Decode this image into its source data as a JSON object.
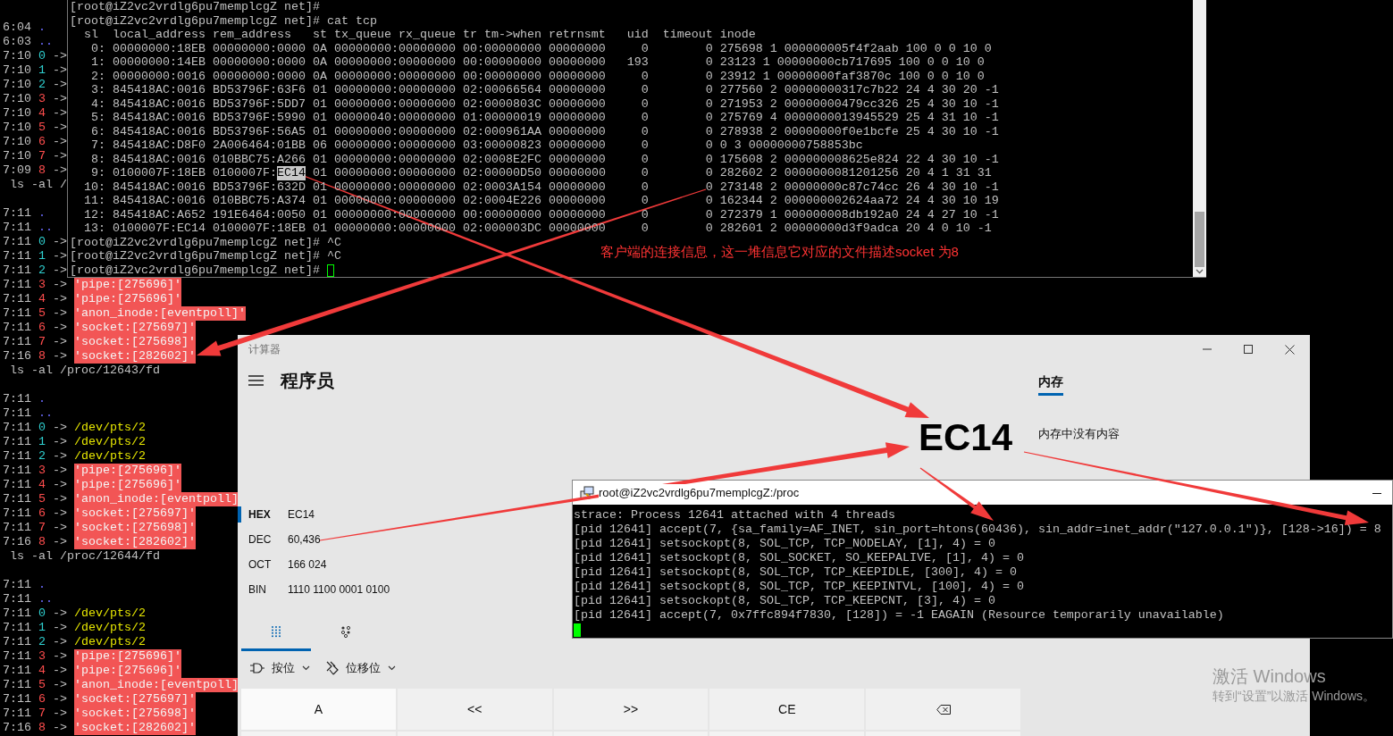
{
  "left_terminal": {
    "lines": [
      {
        "kind": "entry",
        "time": "6:04",
        "name": {
          "text": ".",
          "kind": "dir"
        }
      },
      {
        "kind": "entry",
        "time": "6:03",
        "name": {
          "text": "..",
          "kind": "dir"
        }
      },
      {
        "kind": "entry",
        "time": "7:10",
        "name": {
          "text": "0",
          "kind": "std"
        },
        "arrow": "->"
      },
      {
        "kind": "entry",
        "time": "7:10",
        "name": {
          "text": "1",
          "kind": "std"
        },
        "arrow": "->"
      },
      {
        "kind": "entry",
        "time": "7:10",
        "name": {
          "text": "2",
          "kind": "std"
        },
        "arrow": "->"
      },
      {
        "kind": "entry",
        "time": "7:10",
        "name": {
          "text": "3",
          "kind": "fd"
        },
        "arrow": "->"
      },
      {
        "kind": "entry",
        "time": "7:10",
        "name": {
          "text": "4",
          "kind": "fd"
        },
        "arrow": "->"
      },
      {
        "kind": "entry",
        "time": "7:10",
        "name": {
          "text": "5",
          "kind": "fd"
        },
        "arrow": "->"
      },
      {
        "kind": "entry",
        "time": "7:10",
        "name": {
          "text": "6",
          "kind": "fd"
        },
        "arrow": "->"
      },
      {
        "kind": "entry",
        "time": "7:10",
        "name": {
          "text": "7",
          "kind": "fd"
        },
        "arrow": "->"
      },
      {
        "kind": "entry",
        "time": "7:09",
        "name": {
          "text": "8",
          "kind": "fd"
        },
        "arrow": "->"
      },
      {
        "kind": "command",
        "text": " ls -al /"
      },
      {
        "kind": "blank"
      },
      {
        "kind": "entry",
        "time": "7:11",
        "name": {
          "text": ".",
          "kind": "dir"
        }
      },
      {
        "kind": "entry",
        "time": "7:11",
        "name": {
          "text": "..",
          "kind": "dir"
        }
      },
      {
        "kind": "entry",
        "time": "7:11",
        "name": {
          "text": "0",
          "kind": "std"
        },
        "arrow": "->"
      },
      {
        "kind": "entry",
        "time": "7:11",
        "name": {
          "text": "1",
          "kind": "std"
        },
        "arrow": "->"
      },
      {
        "kind": "entry",
        "time": "7:11",
        "name": {
          "text": "2",
          "kind": "std"
        },
        "arrow": "->"
      },
      {
        "kind": "entry",
        "time": "7:11",
        "name": {
          "text": "3",
          "kind": "fd"
        },
        "arrow": "->",
        "target": {
          "text": "'pipe:[275696]'",
          "kind": "special"
        }
      },
      {
        "kind": "entry",
        "time": "7:11",
        "name": {
          "text": "4",
          "kind": "fd"
        },
        "arrow": "->",
        "target": {
          "text": "'pipe:[275696]'",
          "kind": "special"
        }
      },
      {
        "kind": "entry",
        "time": "7:11",
        "name": {
          "text": "5",
          "kind": "fd"
        },
        "arrow": "->",
        "target": {
          "text": "'anon_inode:[eventpoll]'",
          "kind": "special"
        }
      },
      {
        "kind": "entry",
        "time": "7:11",
        "name": {
          "text": "6",
          "kind": "fd"
        },
        "arrow": "->",
        "target": {
          "text": "'socket:[275697]'",
          "kind": "special"
        }
      },
      {
        "kind": "entry",
        "time": "7:11",
        "name": {
          "text": "7",
          "kind": "fd"
        },
        "arrow": "->",
        "target": {
          "text": "'socket:[275698]'",
          "kind": "special"
        }
      },
      {
        "kind": "entry",
        "time": "7:16",
        "name": {
          "text": "8",
          "kind": "fd"
        },
        "arrow": "->",
        "target": {
          "text": "'socket:[282602]'",
          "kind": "special"
        }
      },
      {
        "kind": "command",
        "text": " ls -al /proc/12643/fd"
      },
      {
        "kind": "blank"
      },
      {
        "kind": "entry",
        "time": "7:11",
        "name": {
          "text": ".",
          "kind": "dir"
        }
      },
      {
        "kind": "entry",
        "time": "7:11",
        "name": {
          "text": "..",
          "kind": "dir"
        }
      },
      {
        "kind": "entry",
        "time": "7:11",
        "name": {
          "text": "0",
          "kind": "std"
        },
        "arrow": "->",
        "target": {
          "text": "/dev/pts/2",
          "kind": "tty"
        }
      },
      {
        "kind": "entry",
        "time": "7:11",
        "name": {
          "text": "1",
          "kind": "std"
        },
        "arrow": "->",
        "target": {
          "text": "/dev/pts/2",
          "kind": "tty"
        }
      },
      {
        "kind": "entry",
        "time": "7:11",
        "name": {
          "text": "2",
          "kind": "std"
        },
        "arrow": "->",
        "target": {
          "text": "/dev/pts/2",
          "kind": "tty"
        }
      },
      {
        "kind": "entry",
        "time": "7:11",
        "name": {
          "text": "3",
          "kind": "fd"
        },
        "arrow": "->",
        "target": {
          "text": "'pipe:[275696]'",
          "kind": "special"
        }
      },
      {
        "kind": "entry",
        "time": "7:11",
        "name": {
          "text": "4",
          "kind": "fd"
        },
        "arrow": "->",
        "target": {
          "text": "'pipe:[275696]'",
          "kind": "special"
        }
      },
      {
        "kind": "entry",
        "time": "7:11",
        "name": {
          "text": "5",
          "kind": "fd"
        },
        "arrow": "->",
        "target": {
          "text": "'anon_inode:[eventpoll]",
          "kind": "special"
        }
      },
      {
        "kind": "entry",
        "time": "7:11",
        "name": {
          "text": "6",
          "kind": "fd"
        },
        "arrow": "->",
        "target": {
          "text": "'socket:[275697]'",
          "kind": "special"
        }
      },
      {
        "kind": "entry",
        "time": "7:11",
        "name": {
          "text": "7",
          "kind": "fd"
        },
        "arrow": "->",
        "target": {
          "text": "'socket:[275698]'",
          "kind": "special"
        }
      },
      {
        "kind": "entry",
        "time": "7:16",
        "name": {
          "text": "8",
          "kind": "fd"
        },
        "arrow": "->",
        "target": {
          "text": "'socket:[282602]'",
          "kind": "special"
        }
      },
      {
        "kind": "command",
        "text": " ls -al /proc/12644/fd"
      },
      {
        "kind": "blank"
      },
      {
        "kind": "entry",
        "time": "7:11",
        "name": {
          "text": ".",
          "kind": "dir"
        }
      },
      {
        "kind": "entry",
        "time": "7:11",
        "name": {
          "text": "..",
          "kind": "dir"
        }
      },
      {
        "kind": "entry",
        "time": "7:11",
        "name": {
          "text": "0",
          "kind": "std"
        },
        "arrow": "->",
        "target": {
          "text": "/dev/pts/2",
          "kind": "tty"
        }
      },
      {
        "kind": "entry",
        "time": "7:11",
        "name": {
          "text": "1",
          "kind": "std"
        },
        "arrow": "->",
        "target": {
          "text": "/dev/pts/2",
          "kind": "tty"
        }
      },
      {
        "kind": "entry",
        "time": "7:11",
        "name": {
          "text": "2",
          "kind": "std"
        },
        "arrow": "->",
        "target": {
          "text": "/dev/pts/2",
          "kind": "tty"
        }
      },
      {
        "kind": "entry",
        "time": "7:11",
        "name": {
          "text": "3",
          "kind": "fd"
        },
        "arrow": "->",
        "target": {
          "text": "'pipe:[275696]'",
          "kind": "special"
        }
      },
      {
        "kind": "entry",
        "time": "7:11",
        "name": {
          "text": "4",
          "kind": "fd"
        },
        "arrow": "->",
        "target": {
          "text": "'pipe:[275696]'",
          "kind": "special"
        }
      },
      {
        "kind": "entry",
        "time": "7:11",
        "name": {
          "text": "5",
          "kind": "fd"
        },
        "arrow": "->",
        "target": {
          "text": "'anon_inode:[eventpoll]",
          "kind": "special"
        }
      },
      {
        "kind": "entry",
        "time": "7:11",
        "name": {
          "text": "6",
          "kind": "fd"
        },
        "arrow": "->",
        "target": {
          "text": "'socket:[275697]'",
          "kind": "special"
        }
      },
      {
        "kind": "entry",
        "time": "7:11",
        "name": {
          "text": "7",
          "kind": "fd"
        },
        "arrow": "->",
        "target": {
          "text": "'socket:[275698]'",
          "kind": "special"
        }
      },
      {
        "kind": "entry",
        "time": "7:16",
        "name": {
          "text": "8",
          "kind": "fd"
        },
        "arrow": "->",
        "target": {
          "text": "'socket:[282602]'",
          "kind": "special"
        }
      }
    ]
  },
  "tcp_terminal": {
    "lines": [
      {
        "text": "[root@iZ2vc2vrdlg6pu7memplcgZ net]#"
      },
      {
        "text": "[root@iZ2vc2vrdlg6pu7memplcgZ net]# cat tcp"
      },
      {
        "text": "  sl  local_address rem_address   st tx_queue rx_queue tr tm->when retrnsmt   uid  timeout inode"
      },
      {
        "text": "   0: 00000000:18EB 00000000:0000 0A 00000000:00000000 00:00000000 00000000     0        0 275698 1 000000005f4f2aab 100 0 0 10 0"
      },
      {
        "text": "   1: 00000000:14EB 00000000:0000 0A 00000000:00000000 00:00000000 00000000   193        0 23123 1 00000000cb717695 100 0 0 10 0"
      },
      {
        "text": "   2: 00000000:0016 00000000:0000 0A 00000000:00000000 00:00000000 00000000     0        0 23912 1 00000000faf3870c 100 0 0 10 0"
      },
      {
        "text": "   3: 845418AC:0016 BD53796F:63F6 01 00000000:00000000 02:00066564 00000000     0        0 277560 2 00000000317c7b22 24 4 30 20 -1"
      },
      {
        "text": "   4: 845418AC:0016 BD53796F:5DD7 01 00000000:00000000 02:0000803C 00000000     0        0 271953 2 00000000479cc326 25 4 30 10 -1"
      },
      {
        "text": "   5: 845418AC:0016 BD53796F:5990 01 00000040:00000000 01:00000019 00000000     0        0 275769 4 0000000013945529 25 4 31 10 -1"
      },
      {
        "text": "   6: 845418AC:0016 BD53796F:56A5 01 00000000:00000000 02:000961AA 00000000     0        0 278938 2 00000000f0e1bcfe 25 4 30 10 -1"
      },
      {
        "text": "   7: 845418AC:D8F0 2A006464:01BB 06 00000000:00000000 03:00000823 00000000     0        0 0 3 00000000758853bc"
      },
      {
        "text": "   8: 845418AC:0016 010BBC75:A266 01 00000000:00000000 02:0008E2FC 00000000     0        0 175608 2 000000008625e824 22 4 30 10 -1"
      },
      {
        "text": "   9: 0100007F:18EB 0100007F:",
        "selected_text": "EC14",
        "text_after": " 01 00000000:00000000 02:00000D50 00000000     0        0 282602 2 0000000081201256 20 4 1 31 31"
      },
      {
        "text": "  10: 845418AC:0016 BD53796F:632D 01 00000000:00000000 02:0003A154 00000000     0        0 273148 2 00000000c87c74cc 26 4 30 10 -1"
      },
      {
        "text": "  11: 845418AC:0016 010BBC75:A374 01 00000000:00000000 02:0004E226 00000000     0        0 162344 2 000000002624aa72 24 4 30 10 19"
      },
      {
        "text": "  12: 845418AC:A652 191E6464:0050 01 00000000:00000000 00:00000000 00000000     0        0 272379 1 000000008db192a0 24 4 27 10 -1"
      },
      {
        "text": "  13: 0100007F:EC14 0100007F:18EB 01 00000000:00000000 02:000003DC 00000000     0        0 282601 2 00000000d3f9adca 20 4 0 10 -1"
      },
      {
        "text": "[root@iZ2vc2vrdlg6pu7memplcgZ net]# ^C"
      },
      {
        "text": "[root@iZ2vc2vrdlg6pu7memplcgZ net]# ^C"
      },
      {
        "text": "[root@iZ2vc2vrdlg6pu7memplcgZ net]# ",
        "cursor": true
      }
    ]
  },
  "annotation": {
    "text": "客户端的连接信息，这一堆信息它对应的文件描述socket 为8"
  },
  "calculator": {
    "title": "计算器",
    "mode": "程序员",
    "display": "EC14",
    "radix": [
      {
        "label": "HEX",
        "value": "EC14",
        "selected": true
      },
      {
        "label": "DEC",
        "value": "60,436",
        "selected": false
      },
      {
        "label": "OCT",
        "value": "166 024",
        "selected": false
      },
      {
        "label": "BIN",
        "value": "1110 1100 0001 0100",
        "selected": false
      }
    ],
    "keypad_tabs": [
      {
        "kind": "keypad",
        "selected": true
      },
      {
        "kind": "bits",
        "selected": false
      }
    ],
    "dropdowns": [
      {
        "label": "按位",
        "kind": "bitwise"
      },
      {
        "label": "位移位",
        "kind": "bitshift"
      }
    ],
    "keys": [
      {
        "label": "A",
        "kind": "digit"
      },
      {
        "label": "<<",
        "kind": "op"
      },
      {
        "label": ">>",
        "kind": "op"
      },
      {
        "label": "CE",
        "kind": "op"
      },
      {
        "kind": "backspace"
      }
    ],
    "memory_tab": {
      "label": "内存",
      "selected": true
    },
    "memory_empty": "内存中没有内容"
  },
  "strace_window": {
    "title": "root@iZ2vc2vrdlg6pu7memplcgZ:/proc",
    "lines": [
      "strace: Process 12641 attached with 4 threads",
      "[pid 12641] accept(7, {sa_family=AF_INET, sin_port=htons(60436), sin_addr=inet_addr(\"127.0.0.1\")}, [128->16]) = 8",
      "[pid 12641] setsockopt(8, SOL_TCP, TCP_NODELAY, [1], 4) = 0",
      "[pid 12641] setsockopt(8, SOL_SOCKET, SO_KEEPALIVE, [1], 4) = 0",
      "[pid 12641] setsockopt(8, SOL_TCP, TCP_KEEPIDLE, [300], 4) = 0",
      "[pid 12641] setsockopt(8, SOL_TCP, TCP_KEEPINTVL, [100], 4) = 0",
      "[pid 12641] setsockopt(8, SOL_TCP, TCP_KEEPCNT, [3], 4) = 0",
      "[pid 12641] accept(7, 0x7ffc894f7830, [128]) = -1 EAGAIN (Resource temporarily unavailable)"
    ]
  },
  "activation_notice": {
    "title": "激活 Windows",
    "text": "转到“设置”以激活 Windows。"
  }
}
